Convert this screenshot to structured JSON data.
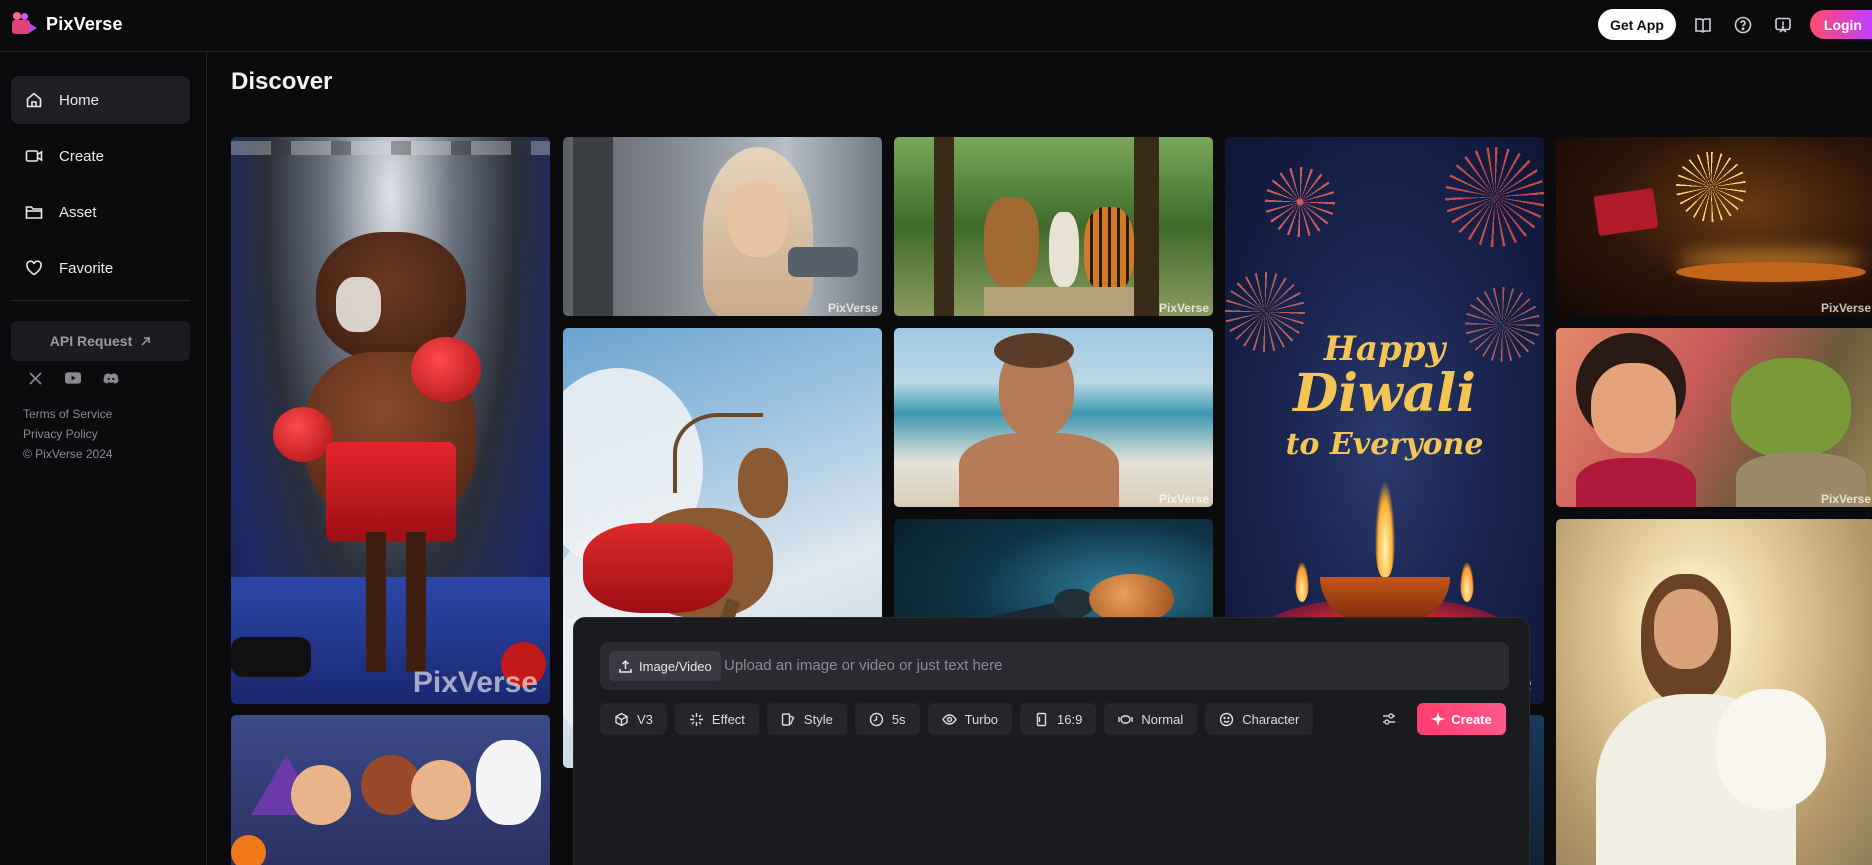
{
  "app": {
    "name": "PixVerse"
  },
  "header": {
    "get_app": "Get App",
    "login": "Login"
  },
  "sidebar": {
    "items": [
      {
        "label": "Home",
        "icon": "home-icon",
        "active": true
      },
      {
        "label": "Create",
        "icon": "video-camera-icon"
      },
      {
        "label": "Asset",
        "icon": "folder-icon"
      },
      {
        "label": "Favorite",
        "icon": "heart-icon"
      }
    ],
    "api_request": "API Request",
    "social": [
      "x-icon",
      "youtube-icon",
      "discord-icon"
    ],
    "footer": {
      "terms": "Terms of Service",
      "privacy": "Privacy Policy",
      "copyright": "© PixVerse 2024"
    }
  },
  "main": {
    "title": "Discover",
    "watermark": "PixVerse",
    "diwali": {
      "line1": "Happy",
      "line2": "Diwali",
      "line3": "to Everyone"
    }
  },
  "composer": {
    "upload_label": "Image/Video",
    "placeholder": "Upload an image or video or just text here",
    "options": [
      {
        "label": "V3",
        "icon": "cube-icon"
      },
      {
        "label": "Effect",
        "icon": "sparkle-icon"
      },
      {
        "label": "Style",
        "icon": "style-icon"
      },
      {
        "label": "5s",
        "icon": "clock-icon"
      },
      {
        "label": "Turbo",
        "icon": "eye-icon"
      },
      {
        "label": "16:9",
        "icon": "aspect-ratio-icon"
      },
      {
        "label": "Normal",
        "icon": "camera-motion-icon"
      },
      {
        "label": "Character",
        "icon": "smile-icon"
      }
    ],
    "create": "Create"
  },
  "colors": {
    "accent": "#ff3d6e",
    "background": "#0b0b0d",
    "panel": "#1a1b1f"
  }
}
